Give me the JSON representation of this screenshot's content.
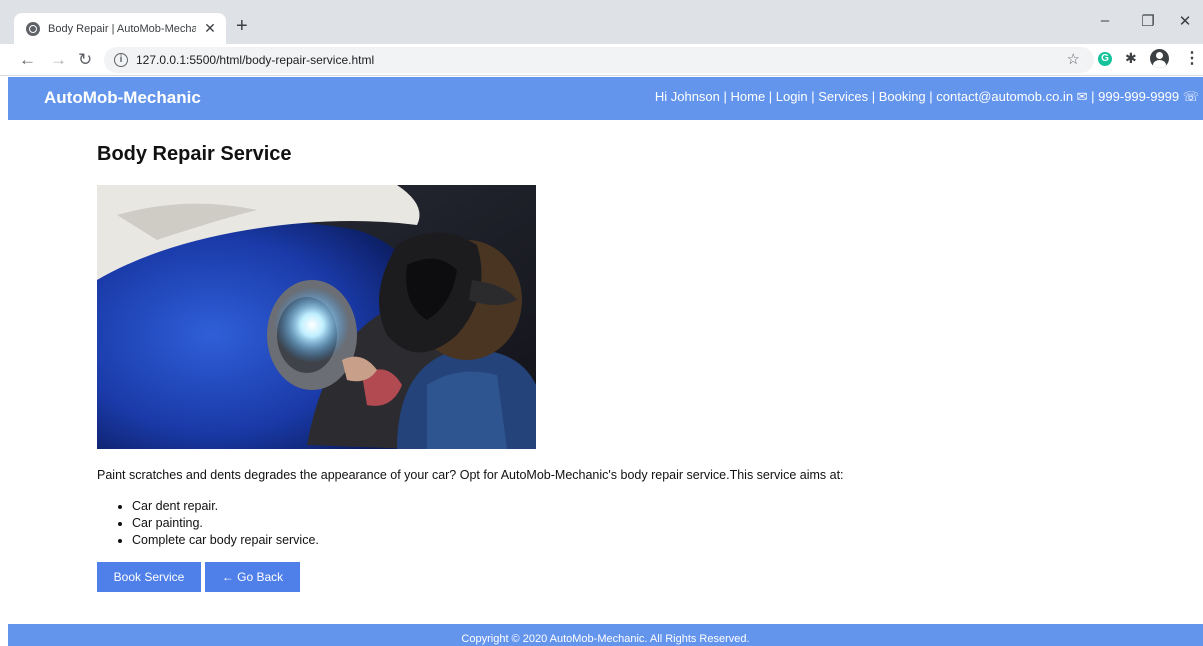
{
  "browser": {
    "tab_title": "Body Repair | AutoMob-Mechanic",
    "tab_close": "✕",
    "new_tab": "+",
    "url": "127.0.0.1:5500/html/body-repair-service.html"
  },
  "header": {
    "brand": "AutoMob-Mechanic",
    "greeting": "Hi Johnson",
    "nav": [
      "Home",
      "Login",
      "Services",
      "Booking"
    ],
    "email": "contact@automob.co.in ✉",
    "phone": "999-999-9999 ☏"
  },
  "main": {
    "title": "Body Repair Service",
    "intro": "Paint scratches and dents degrades the appearance of your car? Opt for AutoMob-Mechanic's body repair service.This service aims at:",
    "features": [
      "Car dent repair.",
      "Car painting.",
      "Complete car body repair service."
    ],
    "book_button": "Book Service",
    "back_button": "← Go Back"
  },
  "footer": {
    "copyright": "Copyright © 2020 AutoMob-Mechanic.  All Rights Reserved."
  },
  "colors": {
    "header_bg": "#6495ed",
    "button_bg": "#4f7fe8"
  }
}
